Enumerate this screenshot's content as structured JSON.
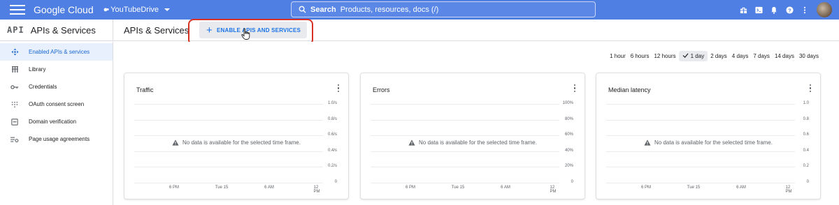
{
  "topbar": {
    "logo": "Google Cloud",
    "project": "YouTubeDrive",
    "search_label": "Search",
    "search_hint": "Products, resources, docs (/)"
  },
  "subheader": {
    "api_logo": "API",
    "product_name": "APIs & Services",
    "page_title": "APIs & Services",
    "enable_button": "ENABLE APIS AND SERVICES"
  },
  "sidebar": {
    "items": [
      {
        "label": "Enabled APIs & services",
        "icon": "diamond-arrows-icon",
        "active": true
      },
      {
        "label": "Library",
        "icon": "library-icon",
        "active": false
      },
      {
        "label": "Credentials",
        "icon": "key-icon",
        "active": false
      },
      {
        "label": "OAuth consent screen",
        "icon": "oauth-icon",
        "active": false
      },
      {
        "label": "Domain verification",
        "icon": "domain-icon",
        "active": false
      },
      {
        "label": "Page usage agreements",
        "icon": "settings-list-icon",
        "active": false
      }
    ]
  },
  "timerange": {
    "options": [
      "1 hour",
      "6 hours",
      "12 hours",
      "1 day",
      "2 days",
      "4 days",
      "7 days",
      "14 days",
      "30 days"
    ],
    "selected": "1 day"
  },
  "cards": [
    {
      "title": "Traffic",
      "y_ticks": [
        "1.0/s",
        "0.8/s",
        "0.6/s",
        "0.4/s",
        "0.2/s",
        "0"
      ],
      "x_ticks": [
        "6 PM",
        "Tue 15",
        "6 AM",
        "12 PM"
      ],
      "message": "No data is available for the selected time frame."
    },
    {
      "title": "Errors",
      "y_ticks": [
        "100%",
        "80%",
        "60%",
        "40%",
        "20%",
        "0"
      ],
      "x_ticks": [
        "6 PM",
        "Tue 15",
        "6 AM",
        "12 PM"
      ],
      "message": "No data is available for the selected time frame."
    },
    {
      "title": "Median latency",
      "y_ticks": [
        "1.0",
        "0.8",
        "0.6",
        "0.4",
        "0.2",
        "0"
      ],
      "x_ticks": [
        "6 PM",
        "Tue 15",
        "6 AM",
        "12 PM"
      ],
      "message": "No data is available for the selected time frame."
    }
  ],
  "colors": {
    "topbar": "#4f7fe3",
    "accent": "#1a73e8",
    "highlight": "#d93025"
  }
}
